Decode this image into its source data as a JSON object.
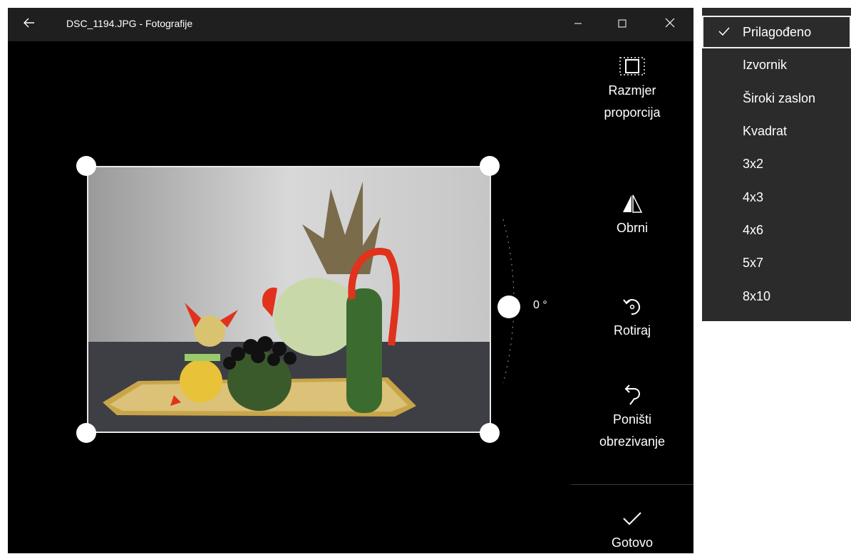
{
  "titlebar": {
    "title": "DSC_1194.JPG - Fotografije",
    "icons": {
      "back": "back-arrow-icon",
      "minimize": "minimize-icon",
      "maximize": "maximize-icon",
      "close": "close-icon"
    }
  },
  "editor": {
    "rotation_label": "0 °",
    "rotation_degrees": 0,
    "photo_description_icon": "photo-image"
  },
  "side_panel": {
    "aspect_ratio_label_line1": "Razmjer",
    "aspect_ratio_label_line2": "proporcija",
    "flip_label": "Obrni",
    "rotate_label": "Rotiraj",
    "reset_label_line1": "Poništi",
    "reset_label_line2": "obrezivanje",
    "done_label": "Gotovo",
    "icons": {
      "aspect_ratio": "aspect-ratio-icon",
      "flip": "flip-icon",
      "rotate": "rotate-icon",
      "reset": "undo-icon",
      "done": "checkmark-icon"
    }
  },
  "aspect_dropdown": {
    "selected_index": 0,
    "items": [
      {
        "label": "Prilagođeno"
      },
      {
        "label": "Izvornik"
      },
      {
        "label": "Široki zaslon"
      },
      {
        "label": "Kvadrat"
      },
      {
        "label": "3x2"
      },
      {
        "label": "4x3"
      },
      {
        "label": "4x6"
      },
      {
        "label": "5x7"
      },
      {
        "label": "8x10"
      }
    ]
  },
  "colors": {
    "titlebar_bg": "#1f1f1f",
    "canvas_bg": "#000000",
    "dropdown_bg": "#2b2b2b",
    "text": "#ffffff"
  }
}
